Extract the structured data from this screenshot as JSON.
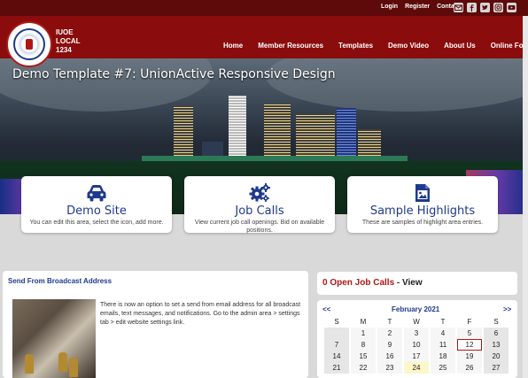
{
  "topbar": {
    "links": [
      "Login",
      "Register",
      "Contact"
    ],
    "icons": [
      "email-icon",
      "facebook-icon",
      "twitter-icon",
      "instagram-icon",
      "youtube-icon"
    ]
  },
  "brand": {
    "line1": "IUOE",
    "line2": "LOCAL",
    "line3": "1234"
  },
  "nav": [
    "Home",
    "Member Resources",
    "Templates",
    "Demo Video",
    "About Us",
    "Online Forms"
  ],
  "hero": {
    "title": "Demo Template #7: UnionActive Responsive Design"
  },
  "cards": [
    {
      "icon": "car-icon",
      "title": "Demo Site",
      "desc": "You can edit this area, select the icon, add more."
    },
    {
      "icon": "gears-icon",
      "title": "Job Calls",
      "desc": "View current job call openings. Bid on available positions."
    },
    {
      "icon": "image-icon",
      "title": "Sample Highlights",
      "desc": "These are samples of highlight area entries."
    }
  ],
  "broadcast": {
    "title": "Send From Broadcast Address",
    "body": "There is now an option to set a send from email address for all broadcast emails, text messages, and notifications. Go to the admin area > settings tab > edit website settings link."
  },
  "jobs": {
    "count_label": "0 Open Job Calls",
    "separator": " - ",
    "view_label": "View"
  },
  "calendar": {
    "prev": "<<",
    "next": ">>",
    "month": "February 2021",
    "weekdays": [
      "S",
      "M",
      "T",
      "W",
      "T",
      "F",
      "S"
    ],
    "weeks": [
      [
        "",
        "1",
        "2",
        "3",
        "4",
        "5",
        "6"
      ],
      [
        "7",
        "8",
        "9",
        "10",
        "11",
        "12",
        "13"
      ],
      [
        "14",
        "15",
        "16",
        "17",
        "18",
        "19",
        "20"
      ],
      [
        "21",
        "22",
        "23",
        "24",
        "25",
        "26",
        "27"
      ]
    ],
    "today": "24",
    "selected": "12"
  },
  "colors": {
    "topbar": "#5e0a0a",
    "header": "#8a0c0c",
    "accent_blue": "#1f3a8c",
    "accent_red": "#b01818"
  }
}
